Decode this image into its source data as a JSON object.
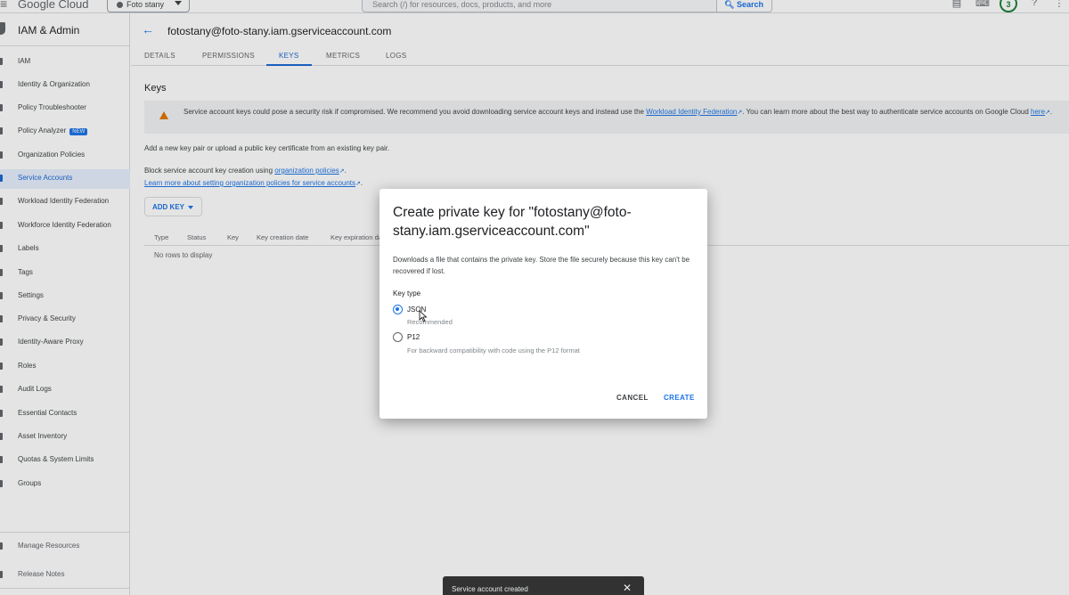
{
  "topbar": {
    "logo": "Google Cloud",
    "project": "Foto stany",
    "search_placeholder": "Search (/) for resources, docs, products, and more",
    "search_button": "Search",
    "notification_count": "3"
  },
  "sidebar": {
    "title": "IAM & Admin",
    "items": [
      {
        "label": "IAM"
      },
      {
        "label": "Identity & Organization"
      },
      {
        "label": "Policy Troubleshooter"
      },
      {
        "label": "Policy Analyzer",
        "badge": "NEW"
      },
      {
        "label": "Organization Policies"
      },
      {
        "label": "Service Accounts"
      },
      {
        "label": "Workload Identity Federation"
      },
      {
        "label": "Workforce Identity Federation"
      },
      {
        "label": "Labels"
      },
      {
        "label": "Tags"
      },
      {
        "label": "Settings"
      },
      {
        "label": "Privacy & Security"
      },
      {
        "label": "Identity-Aware Proxy"
      },
      {
        "label": "Roles"
      },
      {
        "label": "Audit Logs"
      },
      {
        "label": "Essential Contacts"
      },
      {
        "label": "Asset Inventory"
      },
      {
        "label": "Quotas & System Limits"
      },
      {
        "label": "Groups"
      }
    ],
    "footer": [
      {
        "label": "Manage Resources"
      },
      {
        "label": "Release Notes"
      }
    ]
  },
  "main": {
    "title": "fotostany@foto-stany.iam.gserviceaccount.com",
    "tabs": [
      {
        "label": "DETAILS"
      },
      {
        "label": "PERMISSIONS"
      },
      {
        "label": "KEYS"
      },
      {
        "label": "METRICS"
      },
      {
        "label": "LOGS"
      }
    ],
    "section_title": "Keys",
    "warning": {
      "text1": "Service account keys could pose a security risk if compromised. We recommend you avoid downloading service account keys and instead use the ",
      "link1": "Workload Identity Federation",
      "text2": ". You can learn more about the best way to authenticate service accounts on Google Cloud ",
      "link2": "here",
      "text3": "."
    },
    "desc1": "Add a new key pair or upload a public key certificate from an existing key pair.",
    "desc2_text": "Block service account key creation using ",
    "desc2_link": "organization policies",
    "desc3_link": "Learn more about setting organization policies for service accounts",
    "add_key": "ADD KEY",
    "table": {
      "headers": [
        "Type",
        "Status",
        "Key",
        "Key creation date",
        "Key expiration date"
      ],
      "empty": "No rows to display"
    }
  },
  "dialog": {
    "title": "Create private key for \"fotostany@foto-stany.iam.gserviceaccount.com\"",
    "description": "Downloads a file that contains the private key. Store the file securely because this key can't be recovered if lost.",
    "key_type_label": "Key type",
    "options": [
      {
        "label": "JSON",
        "sub": "Recommended",
        "selected": true
      },
      {
        "label": "P12",
        "sub": "For backward compatibility with code using the P12 format",
        "selected": false
      }
    ],
    "cancel": "CANCEL",
    "create": "CREATE"
  },
  "snackbar": {
    "message": "Service account created"
  }
}
